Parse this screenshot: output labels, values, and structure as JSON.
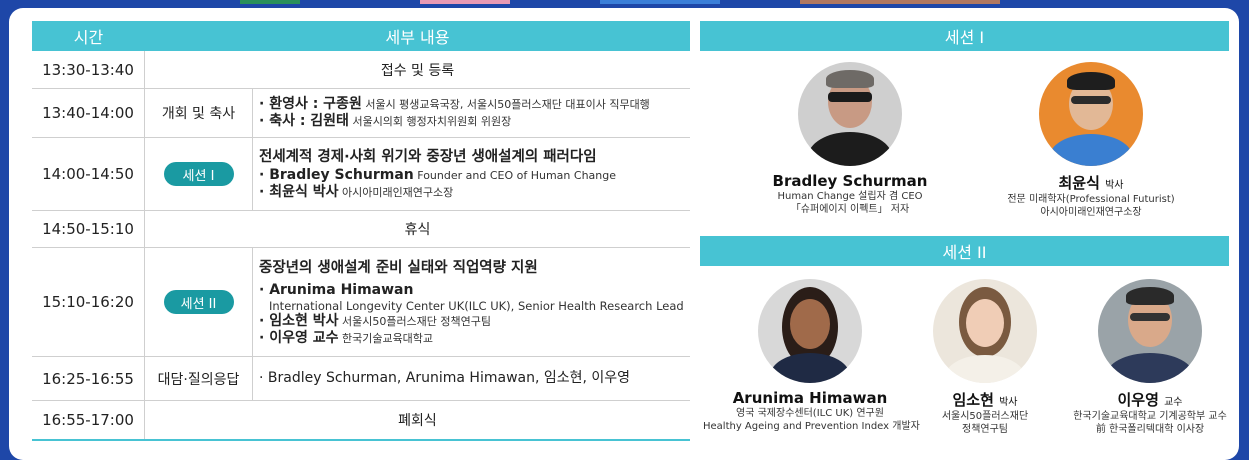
{
  "colors": {
    "accent": "#47c3d3",
    "pill": "#1a9aa2",
    "frame": "#1e47a8"
  },
  "schedule": {
    "header": {
      "time": "시간",
      "detail": "세부 내용"
    },
    "rows": [
      {
        "time": "13:30-13:40",
        "full": "접수 및 등록"
      },
      {
        "time": "13:40-14:00",
        "category": "개회 및 축사",
        "lines": [
          {
            "bold": "· 환영사 : 구종원",
            "small": " 서울시 평생교육국장, 서울시50플러스재단 대표이사 직무대행"
          },
          {
            "bold": "· 축사 : 김원태",
            "small": " 서울시의회 행정자치위원회 위원장"
          }
        ]
      },
      {
        "time": "14:00-14:50",
        "pill": "세션 I",
        "title": "전세계적 경제·사회 위기와 중장년 생애설계의 패러다임",
        "lines": [
          {
            "bold": "· Bradley Schurman",
            "small": " Founder and CEO of Human Change"
          },
          {
            "bold": "· 최윤식 박사",
            "small": " 아시아미래인재연구소장"
          }
        ]
      },
      {
        "time": "14:50-15:10",
        "full": "휴식"
      },
      {
        "time": "15:10-16:20",
        "pill": "세션 II",
        "title": "중장년의 생애설계 준비 실태와 직업역량 지원",
        "lead": "· Arunima Himawan",
        "lead_sub": "International Longevity Center UK(ILC UK), Senior Health Research Lead",
        "lines": [
          {
            "bold": "· 임소현 박사",
            "small": " 서울시50플러스재단 정책연구팀"
          },
          {
            "bold": "· 이우영 교수",
            "small": " 한국기술교육대학교"
          }
        ]
      },
      {
        "time": "16:25-16:55",
        "category": "대담·질의응답",
        "text": "· Bradley Schurman, Arunima Himawan, 임소현, 이우영"
      },
      {
        "time": "16:55-17:00",
        "full": "폐회식"
      }
    ]
  },
  "speakers": {
    "session1_title": "세션 I",
    "session2_title": "세션 II",
    "bradley": {
      "name": "Bradley Schurman",
      "d1": "Human Change 설립자 겸 CEO",
      "d2": "「슈퍼에이지 이펙트」 저자"
    },
    "choi": {
      "name": "최윤식",
      "title": "박사",
      "d1": "전문 미래학자(Professional Futurist)",
      "d2": "아시아미래인재연구소장"
    },
    "arunima": {
      "name": "Arunima Himawan",
      "d1": "영국 국제장수센터(ILC UK) 연구원",
      "d2": "Healthy Ageing and Prevention Index 개발자"
    },
    "lim": {
      "name": "임소현",
      "title": "박사",
      "d1": "서울시50플러스재단",
      "d2": "정책연구팀"
    },
    "lee": {
      "name": "이우영",
      "title": "교수",
      "d1": "한국기술교육대학교 기계공학부 교수",
      "d2": "前 한국폴리텍대학 이사장"
    }
  }
}
